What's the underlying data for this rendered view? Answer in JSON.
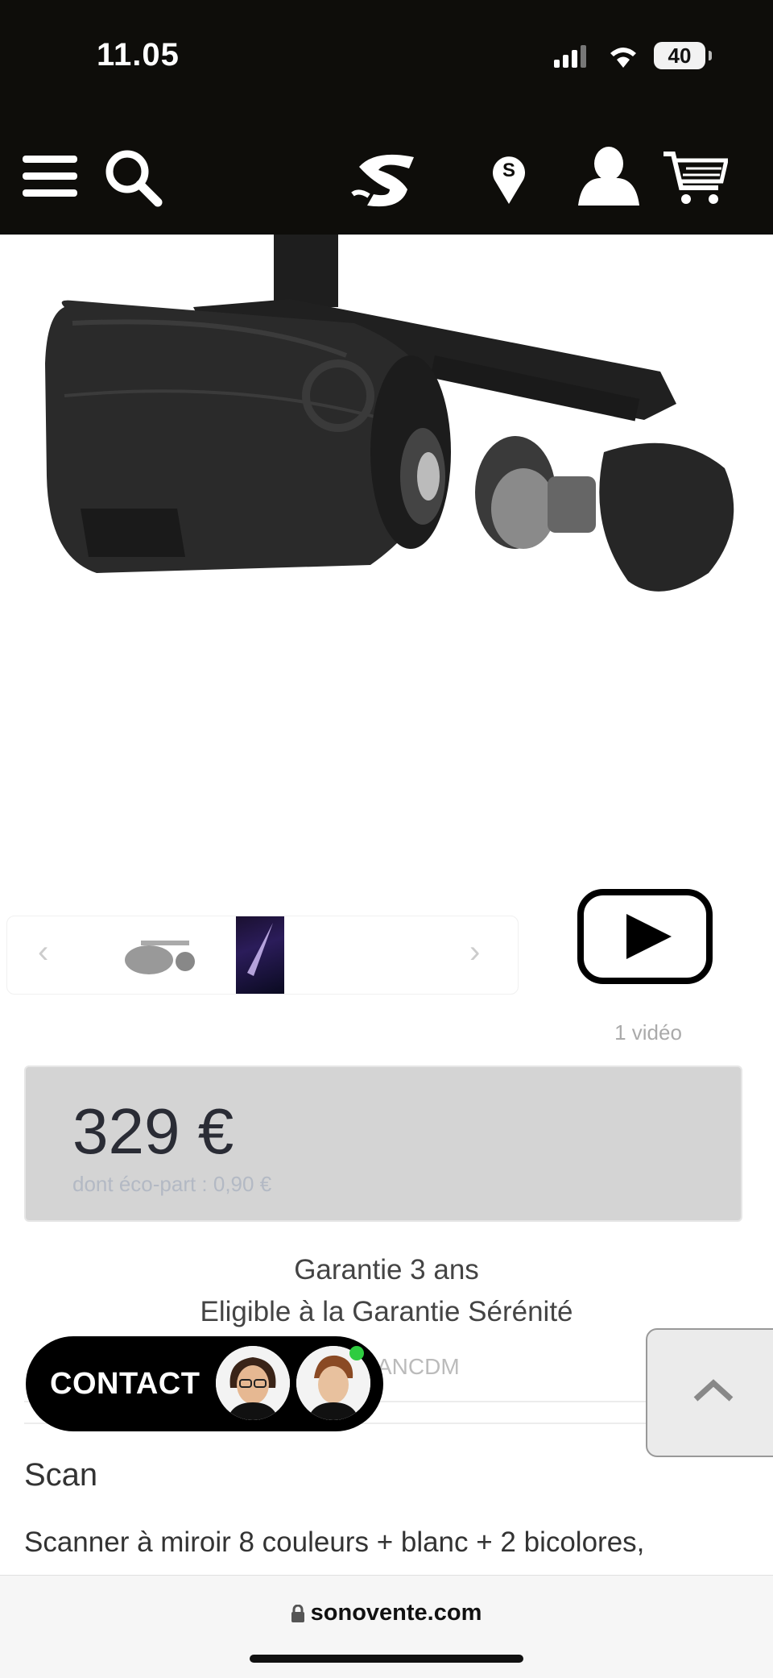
{
  "status_bar": {
    "time": "11.05",
    "battery": "40"
  },
  "nav": {
    "icons": [
      "menu-icon",
      "search-icon",
      "brand-logo",
      "store-locator-icon",
      "account-icon",
      "cart-icon"
    ]
  },
  "product": {
    "video_count": "1 vidéo",
    "price": "329 €",
    "eco_part": "dont éco-part : 0,90 €",
    "guarantee_line1": "Garantie 3  ans",
    "guarantee_line2": "Eligible à la Garantie Sérénité",
    "reference_partial": "ANCDM",
    "section_title": "Scan",
    "description": "Scanner à miroir 8 couleurs + blanc + 2 bicolores,"
  },
  "contact": {
    "label": "CONTACT"
  },
  "browser": {
    "url": "sonovente.com"
  },
  "colors": {
    "header_bg": "#0e0d0a",
    "price_box_bg": "#d4d4d4",
    "online": "#2ecc40"
  }
}
